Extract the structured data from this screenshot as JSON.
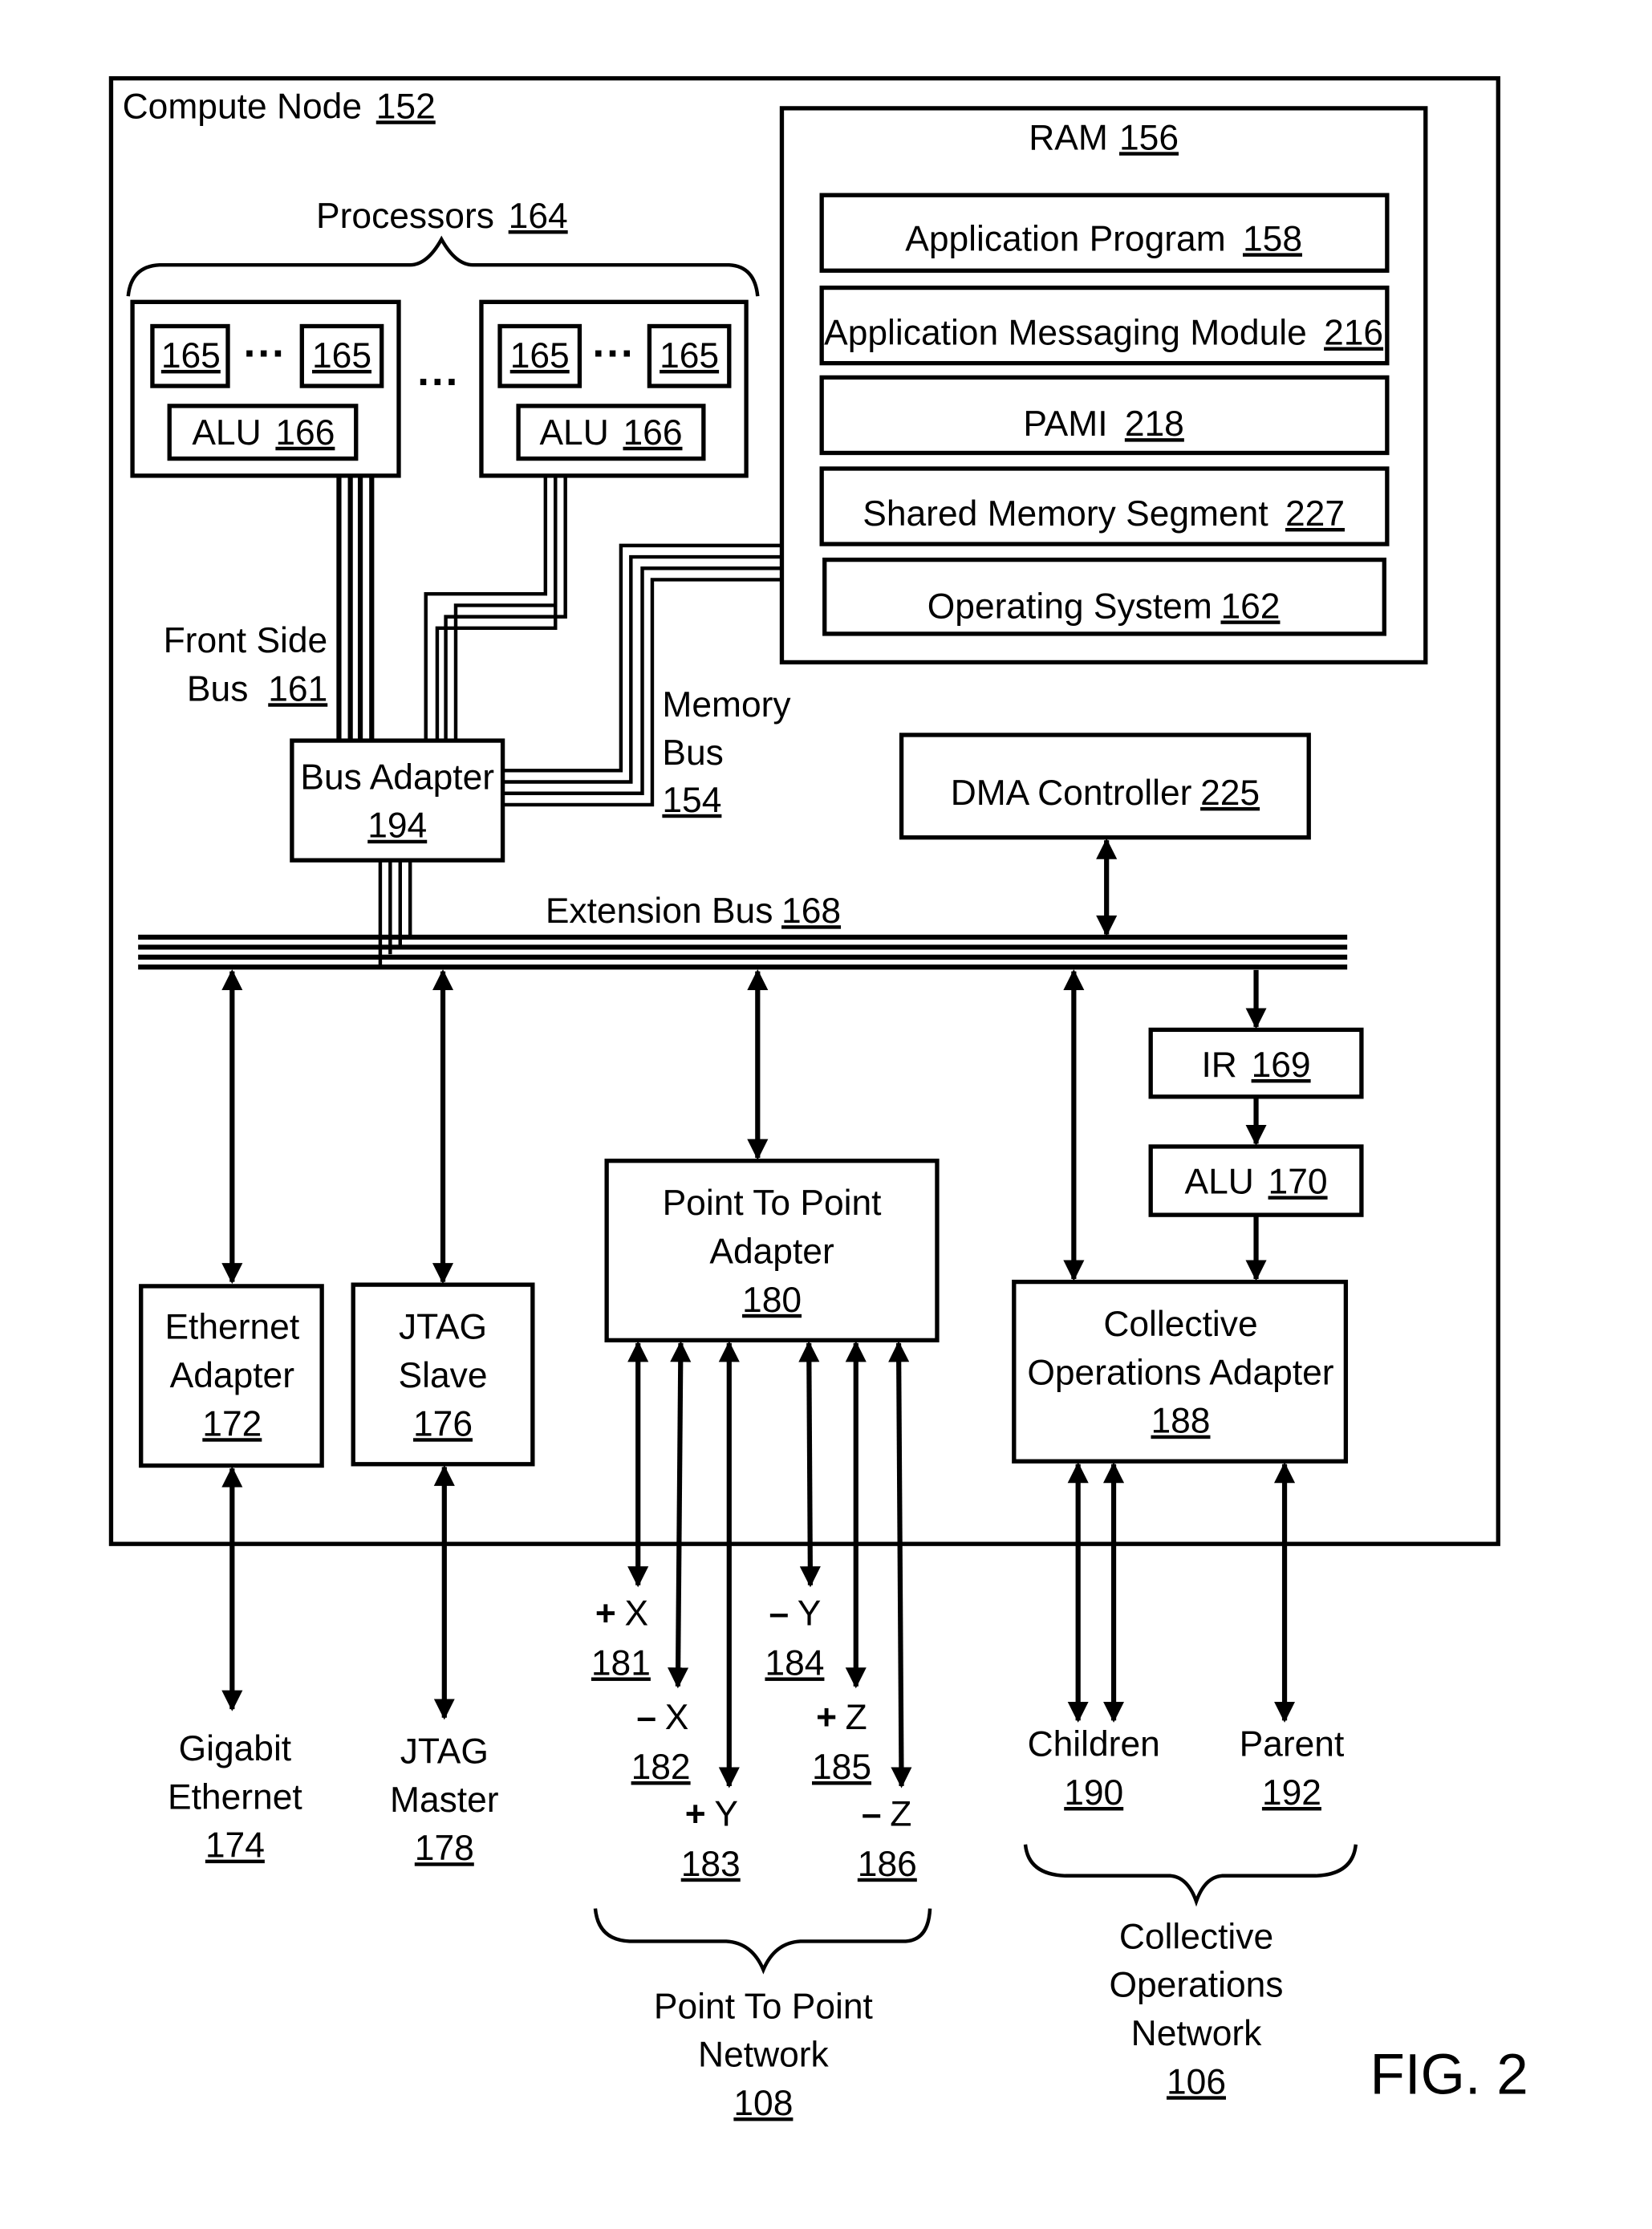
{
  "figure": {
    "caption": "FIG. 2",
    "compute_node": {
      "label": "Compute Node",
      "ref": "152"
    },
    "processors": {
      "label": "Processors",
      "ref": "164"
    },
    "processor_groups": [
      {
        "cores": [
          "165",
          "165"
        ],
        "alu": {
          "label": "ALU",
          "ref": "166"
        }
      },
      {
        "cores": [
          "165",
          "165"
        ],
        "alu": {
          "label": "ALU",
          "ref": "166"
        }
      }
    ],
    "ram": {
      "label": "RAM",
      "ref": "156",
      "modules": [
        {
          "label": "Application Program",
          "ref": "158"
        },
        {
          "label": "Application Messaging Module",
          "ref": "216"
        },
        {
          "label": "PAMI",
          "ref": "218"
        },
        {
          "label": "Shared Memory Segment",
          "ref": "227"
        },
        {
          "label": "Operating System",
          "ref": "162"
        }
      ]
    },
    "front_side_bus": {
      "line1": "Front Side",
      "line2": "Bus",
      "ref": "161"
    },
    "memory_bus": {
      "line1": "Memory",
      "line2": "Bus",
      "ref": "154"
    },
    "bus_adapter": {
      "label": "Bus Adapter",
      "ref": "194"
    },
    "dma_controller": {
      "label": "DMA Controller",
      "ref": "225"
    },
    "extension_bus": {
      "label": "Extension Bus",
      "ref": "168"
    },
    "ir": {
      "label": "IR",
      "ref": "169"
    },
    "alu2": {
      "label": "ALU",
      "ref": "170"
    },
    "ethernet_adapter": {
      "line1": "Ethernet",
      "line2": "Adapter",
      "ref": "172"
    },
    "jtag_slave": {
      "line1": "JTAG",
      "line2": "Slave",
      "ref": "176"
    },
    "p2p_adapter": {
      "line1": "Point To Point",
      "line2": "Adapter",
      "ref": "180"
    },
    "collective_adapter": {
      "line1": "Collective",
      "line2": "Operations Adapter",
      "ref": "188"
    },
    "gigabit_ethernet": {
      "line1": "Gigabit",
      "line2": "Ethernet",
      "ref": "174"
    },
    "jtag_master": {
      "line1": "JTAG",
      "line2": "Master",
      "ref": "178"
    },
    "p2p_links": [
      {
        "sign": "+",
        "axis": "X",
        "ref": "181"
      },
      {
        "sign": "–",
        "axis": "X",
        "ref": "182"
      },
      {
        "sign": "+",
        "axis": "Y",
        "ref": "183"
      },
      {
        "sign": "–",
        "axis": "Y",
        "ref": "184"
      },
      {
        "sign": "+",
        "axis": "Z",
        "ref": "185"
      },
      {
        "sign": "–",
        "axis": "Z",
        "ref": "186"
      }
    ],
    "children": {
      "label": "Children",
      "ref": "190"
    },
    "parent": {
      "label": "Parent",
      "ref": "192"
    },
    "p2p_network": {
      "line1": "Point To Point",
      "line2": "Network",
      "ref": "108"
    },
    "collective_network": {
      "line1": "Collective",
      "line2": "Operations",
      "line3": "Network",
      "ref": "106"
    }
  }
}
